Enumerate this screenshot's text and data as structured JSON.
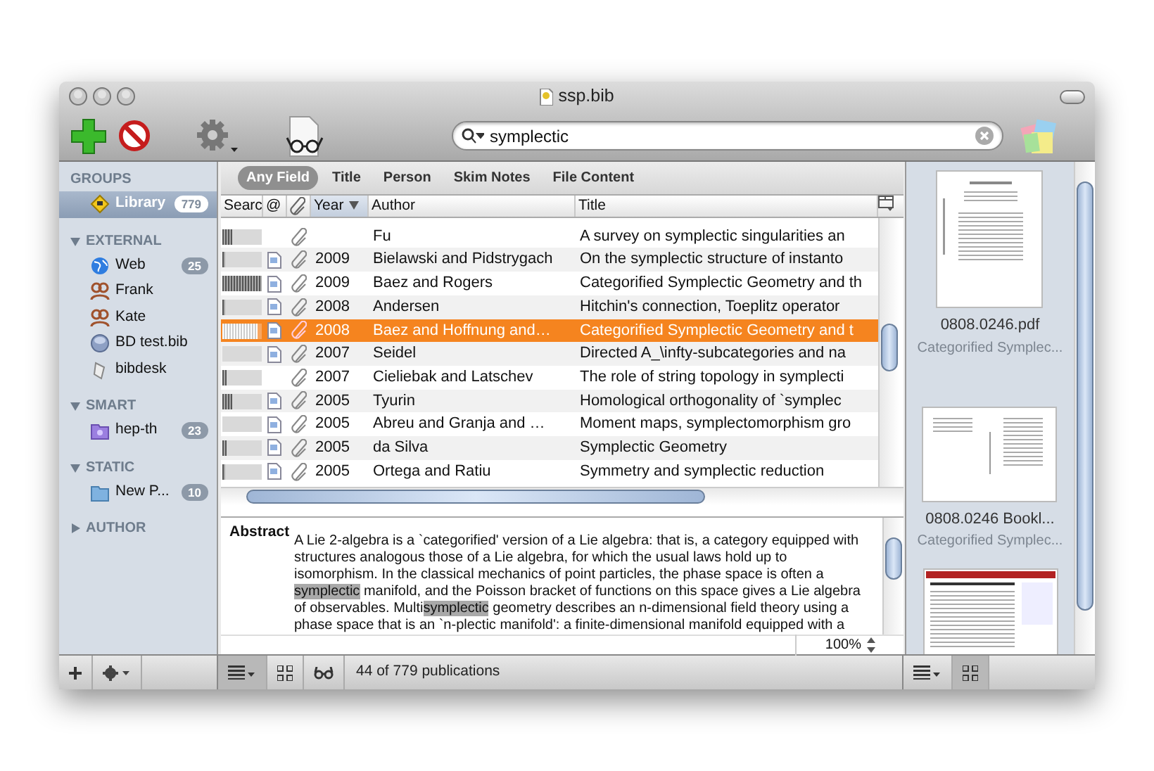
{
  "window": {
    "title": "ssp.bib"
  },
  "search": {
    "value": "symplectic"
  },
  "groups": {
    "title": "GROUPS",
    "items": [
      {
        "label": "Library",
        "count": "779",
        "kind": "library",
        "selected": true
      }
    ]
  },
  "sections": [
    {
      "title": "EXTERNAL",
      "expanded": true,
      "items": [
        {
          "label": "Web",
          "count": "25",
          "kind": "web",
          "selected": false
        },
        {
          "label": "Frank",
          "kind": "shared",
          "selected": false
        },
        {
          "label": "Kate",
          "kind": "shared",
          "selected": false
        },
        {
          "label": "BD test.bib",
          "kind": "file",
          "selected": false
        },
        {
          "label": "bibdesk",
          "kind": "script",
          "selected": false
        }
      ]
    },
    {
      "title": "SMART",
      "expanded": true,
      "items": [
        {
          "label": "hep-th",
          "count": "23",
          "kind": "smart",
          "selected": false
        }
      ]
    },
    {
      "title": "STATIC",
      "expanded": true,
      "items": [
        {
          "label": "New P...",
          "count": "10",
          "kind": "folder",
          "selected": false
        }
      ]
    },
    {
      "title": "AUTHOR",
      "expanded": false
    }
  ],
  "filters": [
    {
      "label": "Any Field",
      "selected": true
    },
    {
      "label": "Title",
      "selected": false
    },
    {
      "label": "Person",
      "selected": false
    },
    {
      "label": "Skim Notes",
      "selected": false
    },
    {
      "label": "File Content",
      "selected": false
    }
  ],
  "table": {
    "columns": [
      {
        "label": "Searc",
        "kind": "text"
      },
      {
        "label": "@",
        "kind": "text"
      },
      {
        "kind": "attachment"
      },
      {
        "label": "Year",
        "kind": "text",
        "sorted": true
      },
      {
        "label": "Author",
        "kind": "text"
      },
      {
        "label": "Title",
        "kind": "text"
      }
    ],
    "rows": [
      {
        "relevance": {
          "level": 0.25
        },
        "file": false,
        "attachment": true,
        "author": "Fu",
        "title": "A survey on symplectic singularities an",
        "selected": false
      },
      {
        "relevance": {
          "level": 0.07
        },
        "file": true,
        "attachment": true,
        "year": "2009",
        "author": "Bielawski and Pidstrygach",
        "title": "On the symplectic structure of instanto",
        "selected": false
      },
      {
        "relevance": {
          "level": 1
        },
        "file": true,
        "attachment": true,
        "year": "2009",
        "author": "Baez and Rogers",
        "title": "Categorified Symplectic Geometry and th",
        "selected": false
      },
      {
        "relevance": {
          "level": 0.07
        },
        "file": true,
        "attachment": true,
        "year": "2008",
        "author": "Andersen",
        "title": "Hitchin's connection, Toeplitz operator",
        "selected": false
      },
      {
        "relevance": {
          "level": 0.9
        },
        "file": true,
        "attachment": true,
        "year": "2008",
        "author": "Baez and Hoffnung and…",
        "title": "Categorified Symplectic Geometry and t",
        "selected": true
      },
      {
        "relevance": {
          "level": 0
        },
        "file": true,
        "attachment": true,
        "year": "2007",
        "author": "Seidel",
        "title": "Directed A_\\infty-subcategories and na",
        "selected": false
      },
      {
        "relevance": {
          "level": 0.1
        },
        "file": false,
        "attachment": true,
        "year": "2007",
        "author": "Cieliebak and Latschev",
        "title": "The role of string topology in symplecti",
        "selected": false
      },
      {
        "relevance": {
          "level": 0.25
        },
        "file": true,
        "attachment": true,
        "year": "2005",
        "author": "Tyurin",
        "title": "Homological orthogonality of `symplec",
        "selected": false
      },
      {
        "relevance": {
          "level": 0
        },
        "file": true,
        "attachment": true,
        "year": "2005",
        "author": "Abreu and Granja and …",
        "title": "Moment maps, symplectomorphism gro",
        "selected": false
      },
      {
        "relevance": {
          "level": 0.12
        },
        "file": true,
        "attachment": true,
        "year": "2005",
        "author": "da Silva",
        "title": "Symplectic Geometry",
        "selected": false
      },
      {
        "relevance": {
          "level": 0.08
        },
        "file": true,
        "attachment": true,
        "year": "2005",
        "author": "Ortega and Ratiu",
        "title": "Symmetry and symplectic reduction",
        "selected": false
      }
    ]
  },
  "abstract": {
    "heading": "Abstract",
    "segments": [
      {
        "text": "A Lie 2-algebra is a `categorified' version of a Lie algebra: that is, a category equipped with structures analogous those of a Lie algebra, for which the usual laws hold up to isomorphism. In the classical mechanics of point particles, the phase space is often a ",
        "highlight": false
      },
      {
        "text": "symplectic",
        "highlight": true
      },
      {
        "text": " manifold, and the Poisson bracket of functions on this space gives a Lie algebra of observables. Multi",
        "highlight": false
      },
      {
        "text": "symplectic",
        "highlight": true
      },
      {
        "text": " geometry describes an n-dimensional field theory using a phase space that is an `n-plectic manifold': a finite-dimensional manifold equipped with a",
        "highlight": false
      }
    ],
    "zoom": "100%"
  },
  "status": "44 of 779 publications",
  "files": [
    {
      "kind": "pdf",
      "name": "0808.0246.pdf",
      "title": "Categorified Symplec..."
    },
    {
      "kind": "booklet",
      "name": "0808.0246 Bookl...",
      "title": "Categorified Symplec..."
    },
    {
      "kind": "web"
    }
  ]
}
